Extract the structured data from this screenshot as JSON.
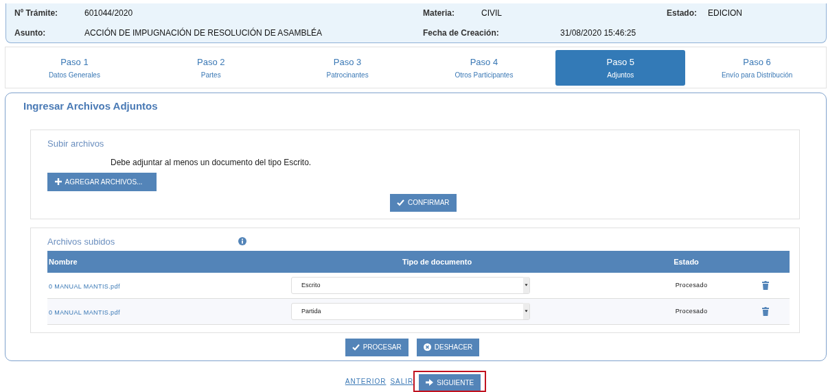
{
  "header": {
    "fields": [
      {
        "label": "Nº Trámite:",
        "value": "601044/2020"
      },
      {
        "label": "Materia:",
        "value": "CIVIL"
      },
      {
        "label": "Estado:",
        "value": "EDICION"
      },
      {
        "label": "Asunto:",
        "value": "ACCIÓN DE IMPUGNACIÓN DE RESOLUCIÓN DE ASAMBLÉA"
      },
      {
        "label": "Fecha de Creación:",
        "value": "31/08/2020 15:46:25"
      }
    ]
  },
  "steps": [
    {
      "title": "Paso 1",
      "subtitle": "Datos Generales",
      "selected": false
    },
    {
      "title": "Paso 2",
      "subtitle": "Partes",
      "selected": false
    },
    {
      "title": "Paso 3",
      "subtitle": "Patrocinantes",
      "selected": false
    },
    {
      "title": "Paso 4",
      "subtitle": "Otros Participantes",
      "selected": false
    },
    {
      "title": "Paso 5",
      "subtitle": "Adjuntos",
      "selected": true
    },
    {
      "title": "Paso 6",
      "subtitle": "Envío para Distribución",
      "selected": false
    }
  ],
  "panel": {
    "title": "Ingresar Archivos Adjuntos",
    "upload": {
      "title": "Subir archivos",
      "notice": "Debe adjuntar al menos un documento del tipo Escrito.",
      "add_button": "AGREGAR ARCHIVOS...",
      "confirm_button": "CONFIRMAR"
    },
    "uploaded": {
      "title": "Archivos subidos",
      "columns": [
        "Nombre",
        "Tipo de documento",
        "Estado"
      ],
      "rows": [
        {
          "name": "0 MANUAL MANTIS.pdf",
          "type": "Escrito",
          "status": "Procesado"
        },
        {
          "name": "0 MANUAL MANTIS.pdf",
          "type": "Partida",
          "status": "Procesado"
        }
      ]
    },
    "buttons": [
      {
        "label": "PROCESAR",
        "kind": "check"
      },
      {
        "label": "DESHACER",
        "kind": "undo"
      }
    ]
  },
  "footer": {
    "links": [
      "ANTERIOR",
      "SALIR"
    ],
    "next_button": {
      "label": "SIGUIENTE",
      "highlighted": true
    }
  }
}
